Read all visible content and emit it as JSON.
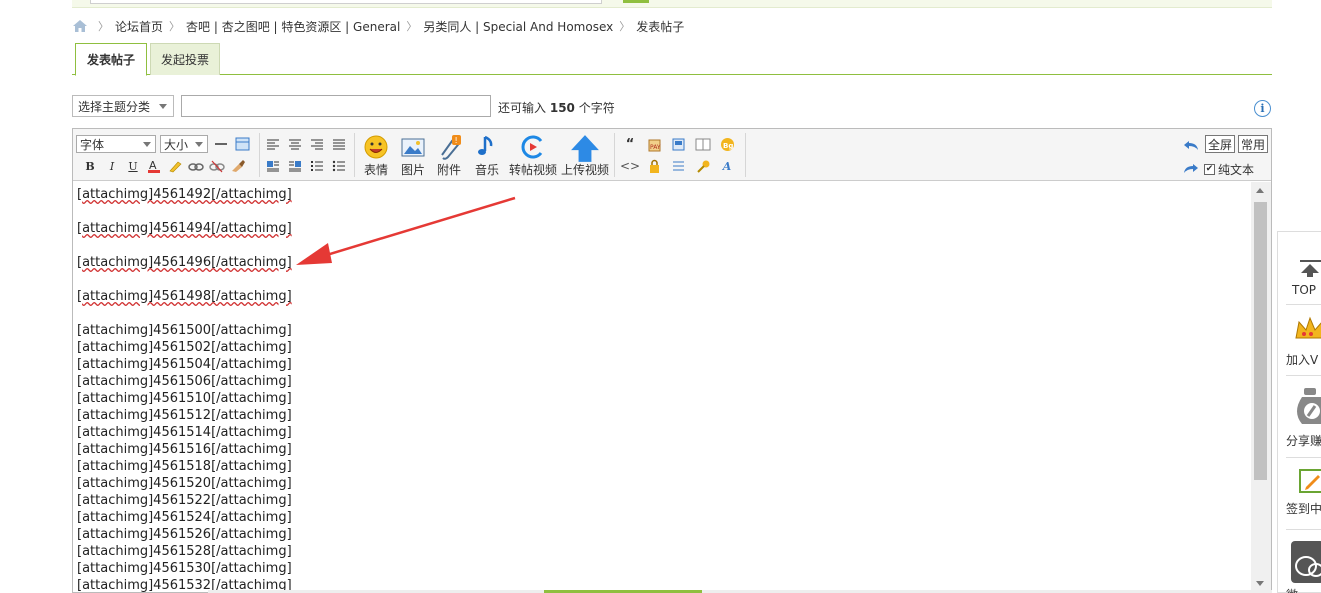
{
  "breadcrumb": {
    "home_icon": "home-icon",
    "items": [
      "论坛首页",
      "杏吧 | 杏之图吧 | 特色资源区 | General",
      "另类同人 | Special And Homosex",
      "发表帖子"
    ],
    "separator": "〉"
  },
  "tabs": [
    {
      "label": "发表帖子",
      "active": true
    },
    {
      "label": "发起投票",
      "active": false
    }
  ],
  "subject": {
    "category_select": "选择主题分类",
    "title_value": "",
    "remain_prefix": "还可输入",
    "remain_count": "150",
    "remain_suffix": "个字符"
  },
  "toolbar": {
    "font_select": "字体",
    "size_select": "大小",
    "big_buttons": [
      "表情",
      "图片",
      "附件",
      "音乐",
      "转帖视频",
      "上传视频"
    ],
    "fullscreen": "全屏",
    "common": "常用",
    "plain_text": "纯文本",
    "plain_text_checked": true
  },
  "editor": {
    "underlined_lines": [
      "[attachimg]4561492[/attachimg]",
      "[attachimg]4561494[/attachimg]",
      "[attachimg]4561496[/attachimg]",
      "[attachimg]4561498[/attachimg]"
    ],
    "lines": [
      "[attachimg]4561500[/attachimg]",
      "[attachimg]4561502[/attachimg]",
      "[attachimg]4561504[/attachimg]",
      "[attachimg]4561506[/attachimg]",
      "[attachimg]4561510[/attachimg]",
      "[attachimg]4561512[/attachimg]",
      "[attachimg]4561514[/attachimg]",
      "[attachimg]4561516[/attachimg]",
      "[attachimg]4561518[/attachimg]",
      "[attachimg]4561520[/attachimg]",
      "[attachimg]4561522[/attachimg]",
      "[attachimg]4561524[/attachimg]",
      "[attachimg]4561526[/attachimg]",
      "[attachimg]4561528[/attachimg]",
      "[attachimg]4561530[/attachimg]",
      "[attachimg]4561532[/attachimg]"
    ]
  },
  "sidebar": {
    "items": [
      "TOP",
      "加入V",
      "分享赚",
      "签到中",
      "微"
    ]
  },
  "colors": {
    "accent_green": "#8fbf3f",
    "annotation_red": "#e53935",
    "link_blue": "#2a6fb5"
  }
}
